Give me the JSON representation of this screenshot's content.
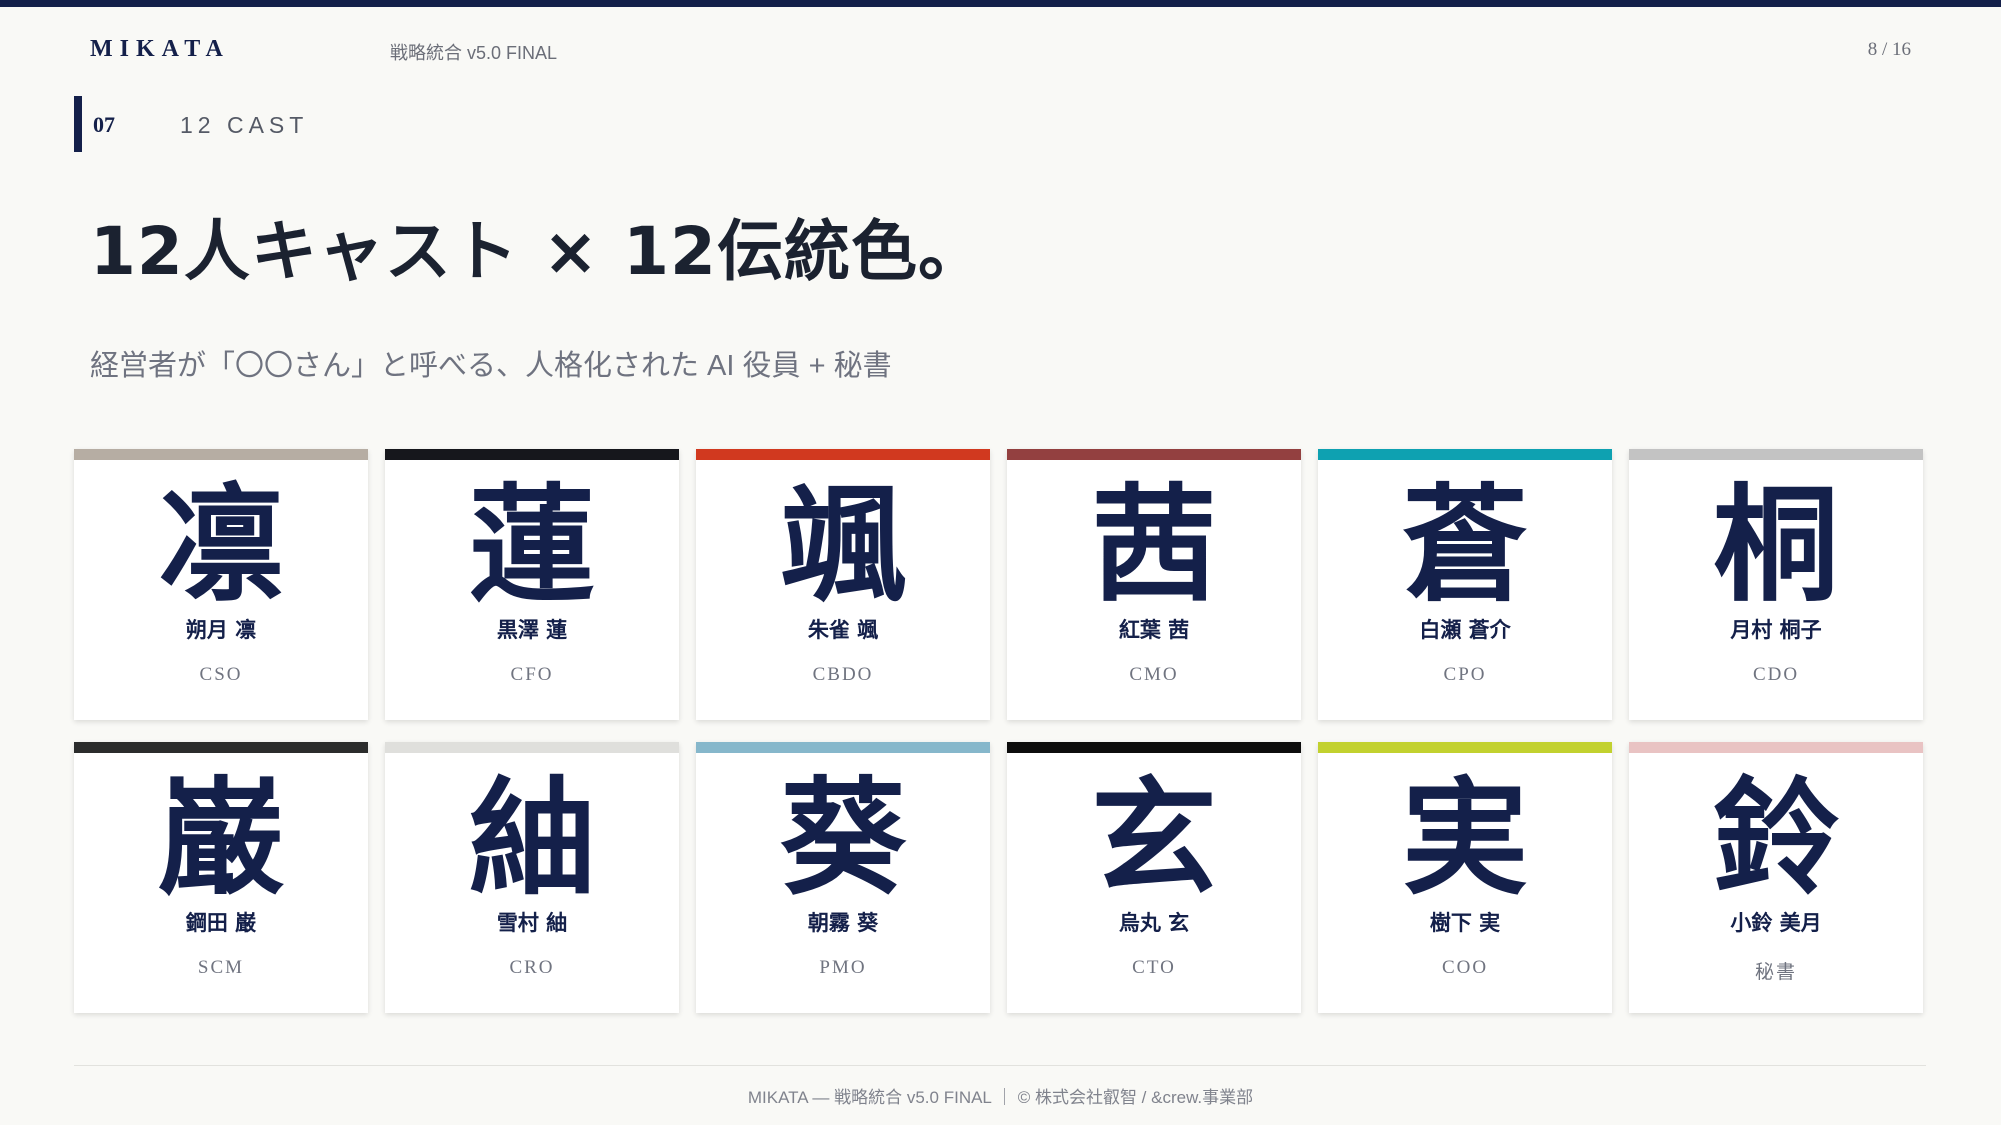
{
  "header": {
    "brand": "MIKATA",
    "doc_title": "戦略統合 v5.0 FINAL",
    "page": "8 / 16"
  },
  "section": {
    "number": "07",
    "label": "12 CAST"
  },
  "headline": "12人キャスト × 12伝統色。",
  "subtitle": "経営者が「〇〇さん」と呼べる、人格化された AI 役員 + 秘書",
  "cast": [
    {
      "kanji": "凛",
      "name": "朔月 凛",
      "role": "CSO",
      "color": "#b6ada3"
    },
    {
      "kanji": "蓮",
      "name": "黒澤 蓮",
      "role": "CFO",
      "color": "#16171c"
    },
    {
      "kanji": "颯",
      "name": "朱雀 颯",
      "role": "CBDO",
      "color": "#d1391f"
    },
    {
      "kanji": "茜",
      "name": "紅葉 茜",
      "role": "CMO",
      "color": "#934040"
    },
    {
      "kanji": "蒼",
      "name": "白瀬 蒼介",
      "role": "CPO",
      "color": "#0ea1b1"
    },
    {
      "kanji": "桐",
      "name": "月村 桐子",
      "role": "CDO",
      "color": "#c3c3c3"
    },
    {
      "kanji": "巌",
      "name": "鋼田 巌",
      "role": "SCM",
      "color": "#2b2c2c"
    },
    {
      "kanji": "紬",
      "name": "雪村 紬",
      "role": "CRO",
      "color": "#dfdfdc"
    },
    {
      "kanji": "葵",
      "name": "朝霧 葵",
      "role": "PMO",
      "color": "#86b7cb"
    },
    {
      "kanji": "玄",
      "name": "烏丸 玄",
      "role": "CTO",
      "color": "#0d0d0d"
    },
    {
      "kanji": "実",
      "name": "樹下 実",
      "role": "COO",
      "color": "#c2d12f"
    },
    {
      "kanji": "鈴",
      "name": "小鈴 美月",
      "role": "秘書",
      "color": "#e9c3c3"
    }
  ],
  "footer": "MIKATA — 戦略統合 v5.0 FINAL ｜ © 株式会社叡智 / &crew.事業部"
}
